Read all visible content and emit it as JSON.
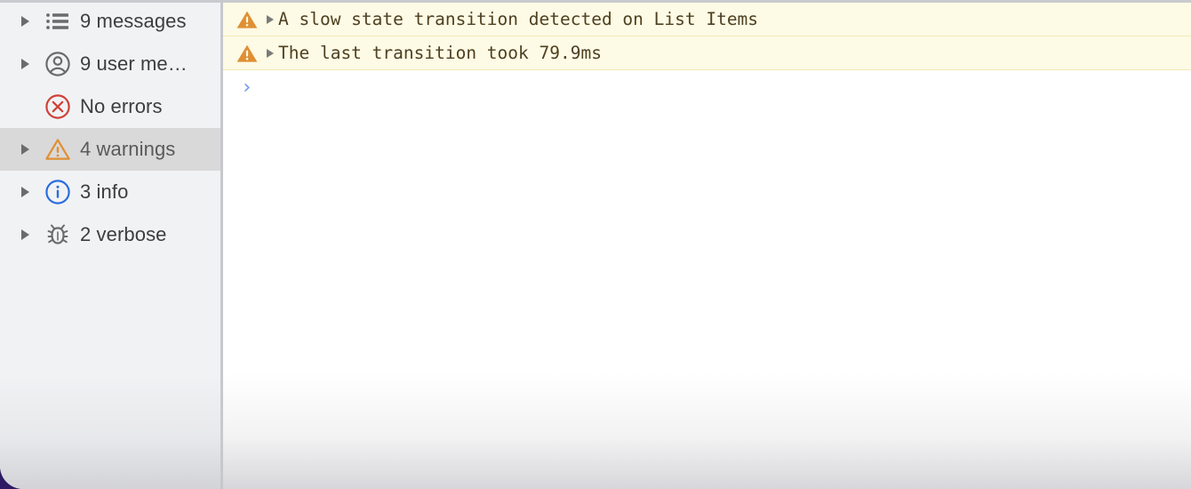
{
  "colors": {
    "sidebar_bg": "#f1f2f4",
    "sidebar_selected_bg": "#d9d9d9",
    "divider": "#c7c8cc",
    "warning_row_bg": "#fdfae5",
    "warning_row_border": "#f2eab8",
    "warning_orange": "#e08f33",
    "error_red": "#cf4136",
    "info_blue": "#2b6cdf",
    "verbose_gray": "#6b6b6b",
    "console_text": "#4f4020",
    "prompt_blue": "#6e96f0",
    "window_backdrop": "#2e1a63"
  },
  "sidebar": {
    "items": [
      {
        "label": "9 messages",
        "icon": "list-icon",
        "has_disclosure": true,
        "selected": false
      },
      {
        "label": "9 user me…",
        "icon": "user-circle-icon",
        "has_disclosure": true,
        "selected": false
      },
      {
        "label": "No errors",
        "icon": "error-circle-icon",
        "has_disclosure": false,
        "selected": false
      },
      {
        "label": "4 warnings",
        "icon": "warning-triangle-icon",
        "has_disclosure": true,
        "selected": true
      },
      {
        "label": "3 info",
        "icon": "info-circle-icon",
        "has_disclosure": true,
        "selected": false
      },
      {
        "label": "2 verbose",
        "icon": "bug-icon",
        "has_disclosure": true,
        "selected": false
      }
    ]
  },
  "console": {
    "messages": [
      {
        "level": "warning",
        "icon": "warning-triangle-filled-icon",
        "expander": "chevron-right-icon",
        "text": "A slow state transition detected on List Items"
      },
      {
        "level": "warning",
        "icon": "warning-triangle-filled-icon",
        "expander": "chevron-right-icon",
        "text": "The last transition took 79.9ms"
      }
    ],
    "prompt": {
      "chevron": "›",
      "value": "",
      "placeholder": ""
    }
  }
}
